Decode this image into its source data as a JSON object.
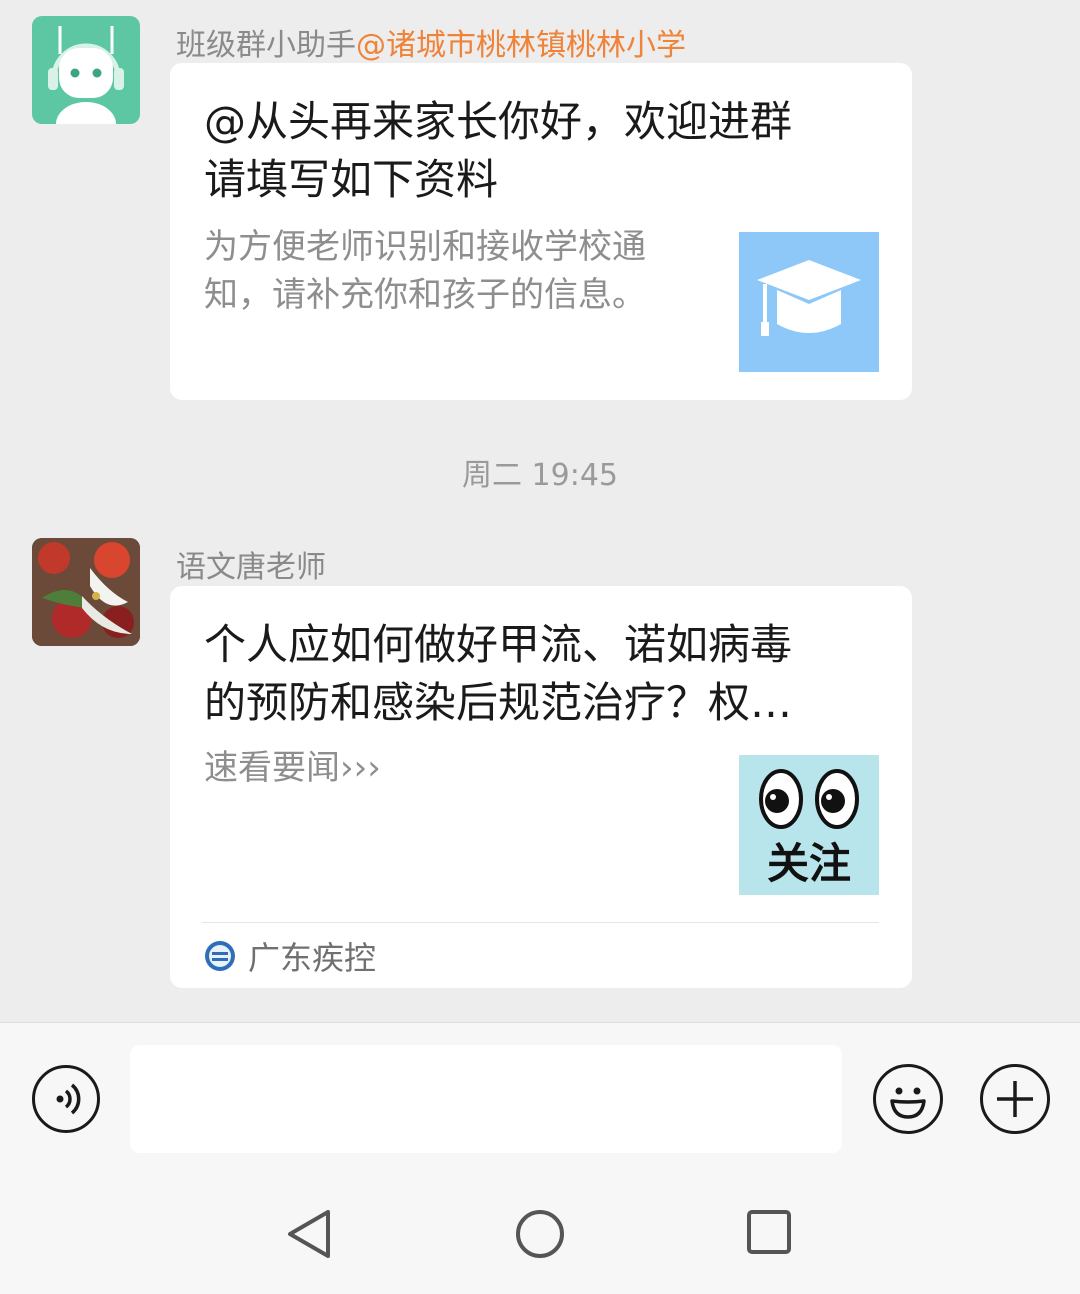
{
  "messages": [
    {
      "sender_name": "班级群小助手",
      "sender_mention": "@诸城市桃林镇桃林小学",
      "card": {
        "title_line1": "@从头再来家长你好，欢迎进群",
        "title_line2": "请填写如下资料",
        "desc_line1": "为方便老师识别和接收学校通",
        "desc_line2": "知，请补充你和孩子的信息。",
        "thumb_icon": "graduation-cap-icon",
        "thumb_color": "#8ec8f8"
      }
    },
    {
      "sender_name": "语文唐老师",
      "card": {
        "title_line1": "个人应如何做好甲流、诺如病毒",
        "title_line2": "的预防和感染后规范治疗？权…",
        "desc_line1": "速看要闻›››",
        "thumb_text": "关注",
        "thumb_color": "#b8e4ec",
        "source_name": "广东疾控"
      }
    }
  ],
  "timestamp": "周二 19:45",
  "colors": {
    "mention": "#f0833a",
    "bot_avatar": "#5cc7a2",
    "background": "#ededed"
  },
  "input_bar": {
    "voice_icon": "voice-icon",
    "emoji_icon": "emoji-icon",
    "plus_icon": "plus-icon"
  }
}
